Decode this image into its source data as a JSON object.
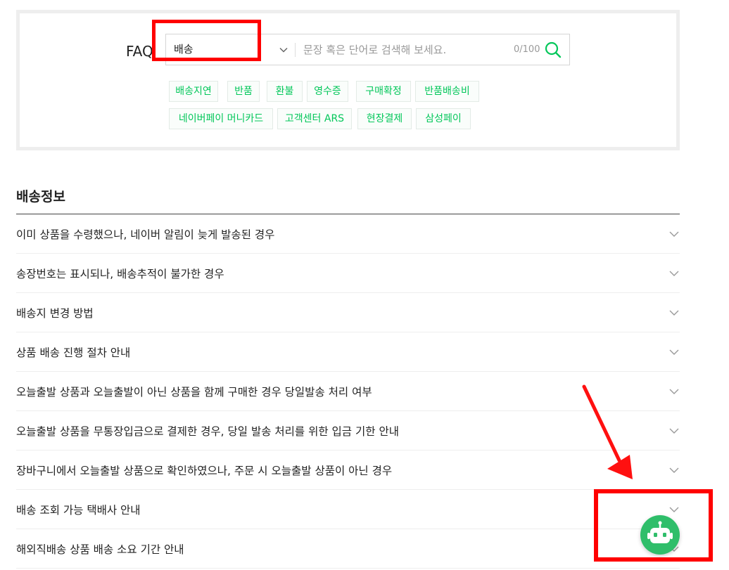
{
  "search": {
    "faq_label": "FAQ",
    "category_value": "배송",
    "placeholder": "문장 혹은 단어로 검색해 보세요.",
    "char_count": "0/100"
  },
  "chips": [
    "배송지연",
    "반품",
    "환불",
    "영수증",
    "구매확정",
    "반품배송비",
    "네이버페이 머니카드",
    "고객센터 ARS",
    "현장결제",
    "삼성페이"
  ],
  "section": {
    "title": "배송정보"
  },
  "faq_items": [
    "이미 상품을 수령했으나, 네이버 알림이 늦게 발송된 경우",
    "송장번호는 표시되나, 배송추적이 불가한 경우",
    "배송지 변경 방법",
    "상품 배송 진행 절차 안내",
    "오늘출발 상품과 오늘출발이 아닌 상품을 함께 구매한 경우 당일발송 처리 여부",
    "오늘출발 상품을 무통장입금으로 결제한 경우, 당일 발송 처리를 위한 입금 기한 안내",
    "장바구니에서 오늘출발 상품으로 확인하였으나, 주문 시 오늘출발 상품이 아닌 경우",
    "배송 조회 가능 택배사 안내",
    "해외직배송 상품 배송 소요 기간 안내"
  ],
  "icons": {
    "select_chevron": "chevron-down-icon",
    "search": "search-icon",
    "item_chevron": "chevron-down-icon",
    "chatbot": "robot-icon"
  },
  "colors": {
    "accent_green": "#03c75a",
    "chatbot_green": "#2fbe6a",
    "annotation_red": "#ff0000"
  }
}
